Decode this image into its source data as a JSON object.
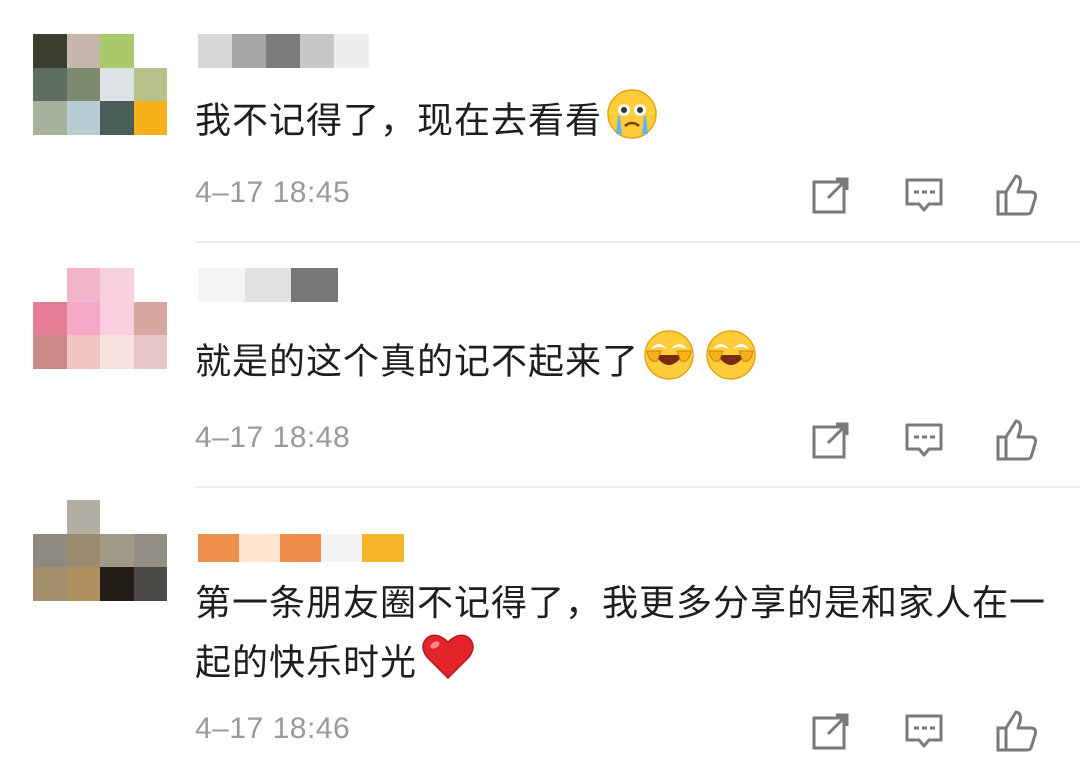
{
  "comments": [
    {
      "text": "我不记得了，现在去看看",
      "emoji": [
        "crying-face-emoji"
      ],
      "time": "4–17 18:45",
      "name_colors": [
        "#d8d8d8",
        "#a5a5a5",
        "#7c7c7c",
        "#c8c8c8",
        "#eeeeee"
      ],
      "avatar_colors": [
        "#3b3d2f",
        "#c7b6ad",
        "#a9c96a",
        "#ffffff",
        "#5d6e61",
        "#7d8a6b",
        "#dde2e6",
        "#b9c18b",
        "#a5b19b",
        "#b8ccd4",
        "#4a5d57",
        "#f7b21b"
      ]
    },
    {
      "text": "就是的这个真的记不起来了",
      "emoji": [
        "laughing-covering-face-emoji",
        "laughing-covering-face-emoji"
      ],
      "time": "4–17 18:48",
      "name_colors": [
        "#f4f4f4",
        "#e2e2e2",
        "#777777"
      ],
      "avatar_colors": [
        "#ffffff",
        "#f1b4ca",
        "#f7d0df",
        "#ffffff",
        "#e57c96",
        "#f5a8c6",
        "#f9cfe0",
        "#d9a59f",
        "#c98a85",
        "#f0c4c0",
        "#f7e2de",
        "#e7c6c6"
      ]
    },
    {
      "text": "第一条朋友圈不记得了，我更多分享的是和家人在一起的快乐时光",
      "emoji": [
        "red-heart-emoji"
      ],
      "time": "4–17 18:46",
      "name_colors": [
        "#ef8f4e",
        "#fde5cf",
        "#ee8c4b",
        "#f2f2f2",
        "#f7b52e"
      ],
      "avatar_colors": [
        "#ffffff",
        "#b3aea4",
        "#ffffff",
        "#ffffff",
        "#8f8a80",
        "#9a8a6f",
        "#a19887",
        "#938f86",
        "#a28f6d",
        "#b19060",
        "#231d17",
        "#4b4a45"
      ]
    }
  ],
  "actions": {
    "share_icon": "share-icon",
    "comment_icon": "comment-icon",
    "like_icon": "like-icon"
  },
  "colors": {
    "text": "#1e1e1e",
    "time": "#9a9a9a",
    "icon": "#7a7a7a",
    "divider": "#ececec"
  }
}
